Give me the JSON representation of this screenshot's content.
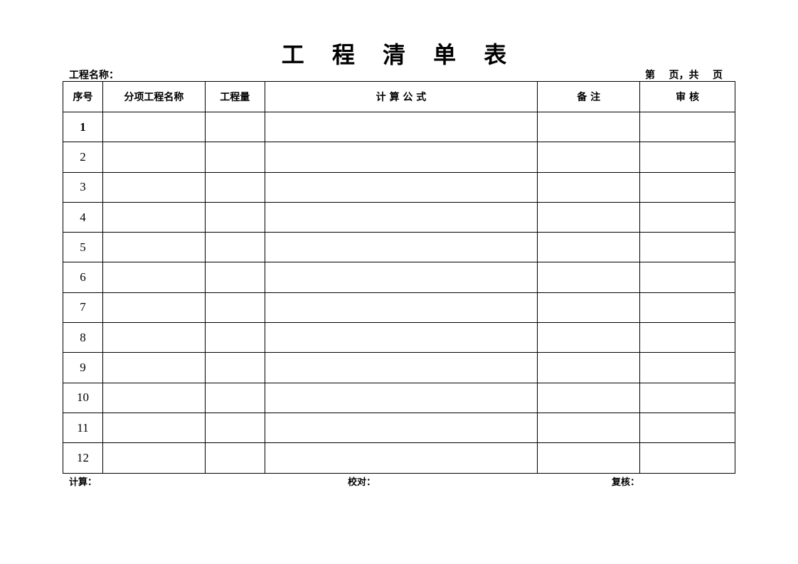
{
  "title": "工 程 清 单 表",
  "project_name_label": "工程名称：",
  "page_info": "第    页，共    页",
  "table": {
    "headers": [
      "序号",
      "分项工程名称",
      "工程量",
      "计 算 公 式",
      "备    注",
      "审    核"
    ],
    "rows": [
      "1",
      "2",
      "3",
      "4",
      "5",
      "6",
      "7",
      "8",
      "9",
      "10",
      "11",
      "12"
    ]
  },
  "footer": {
    "calc_label": "计算：",
    "check_label": "校对：",
    "review_label": "复核："
  }
}
